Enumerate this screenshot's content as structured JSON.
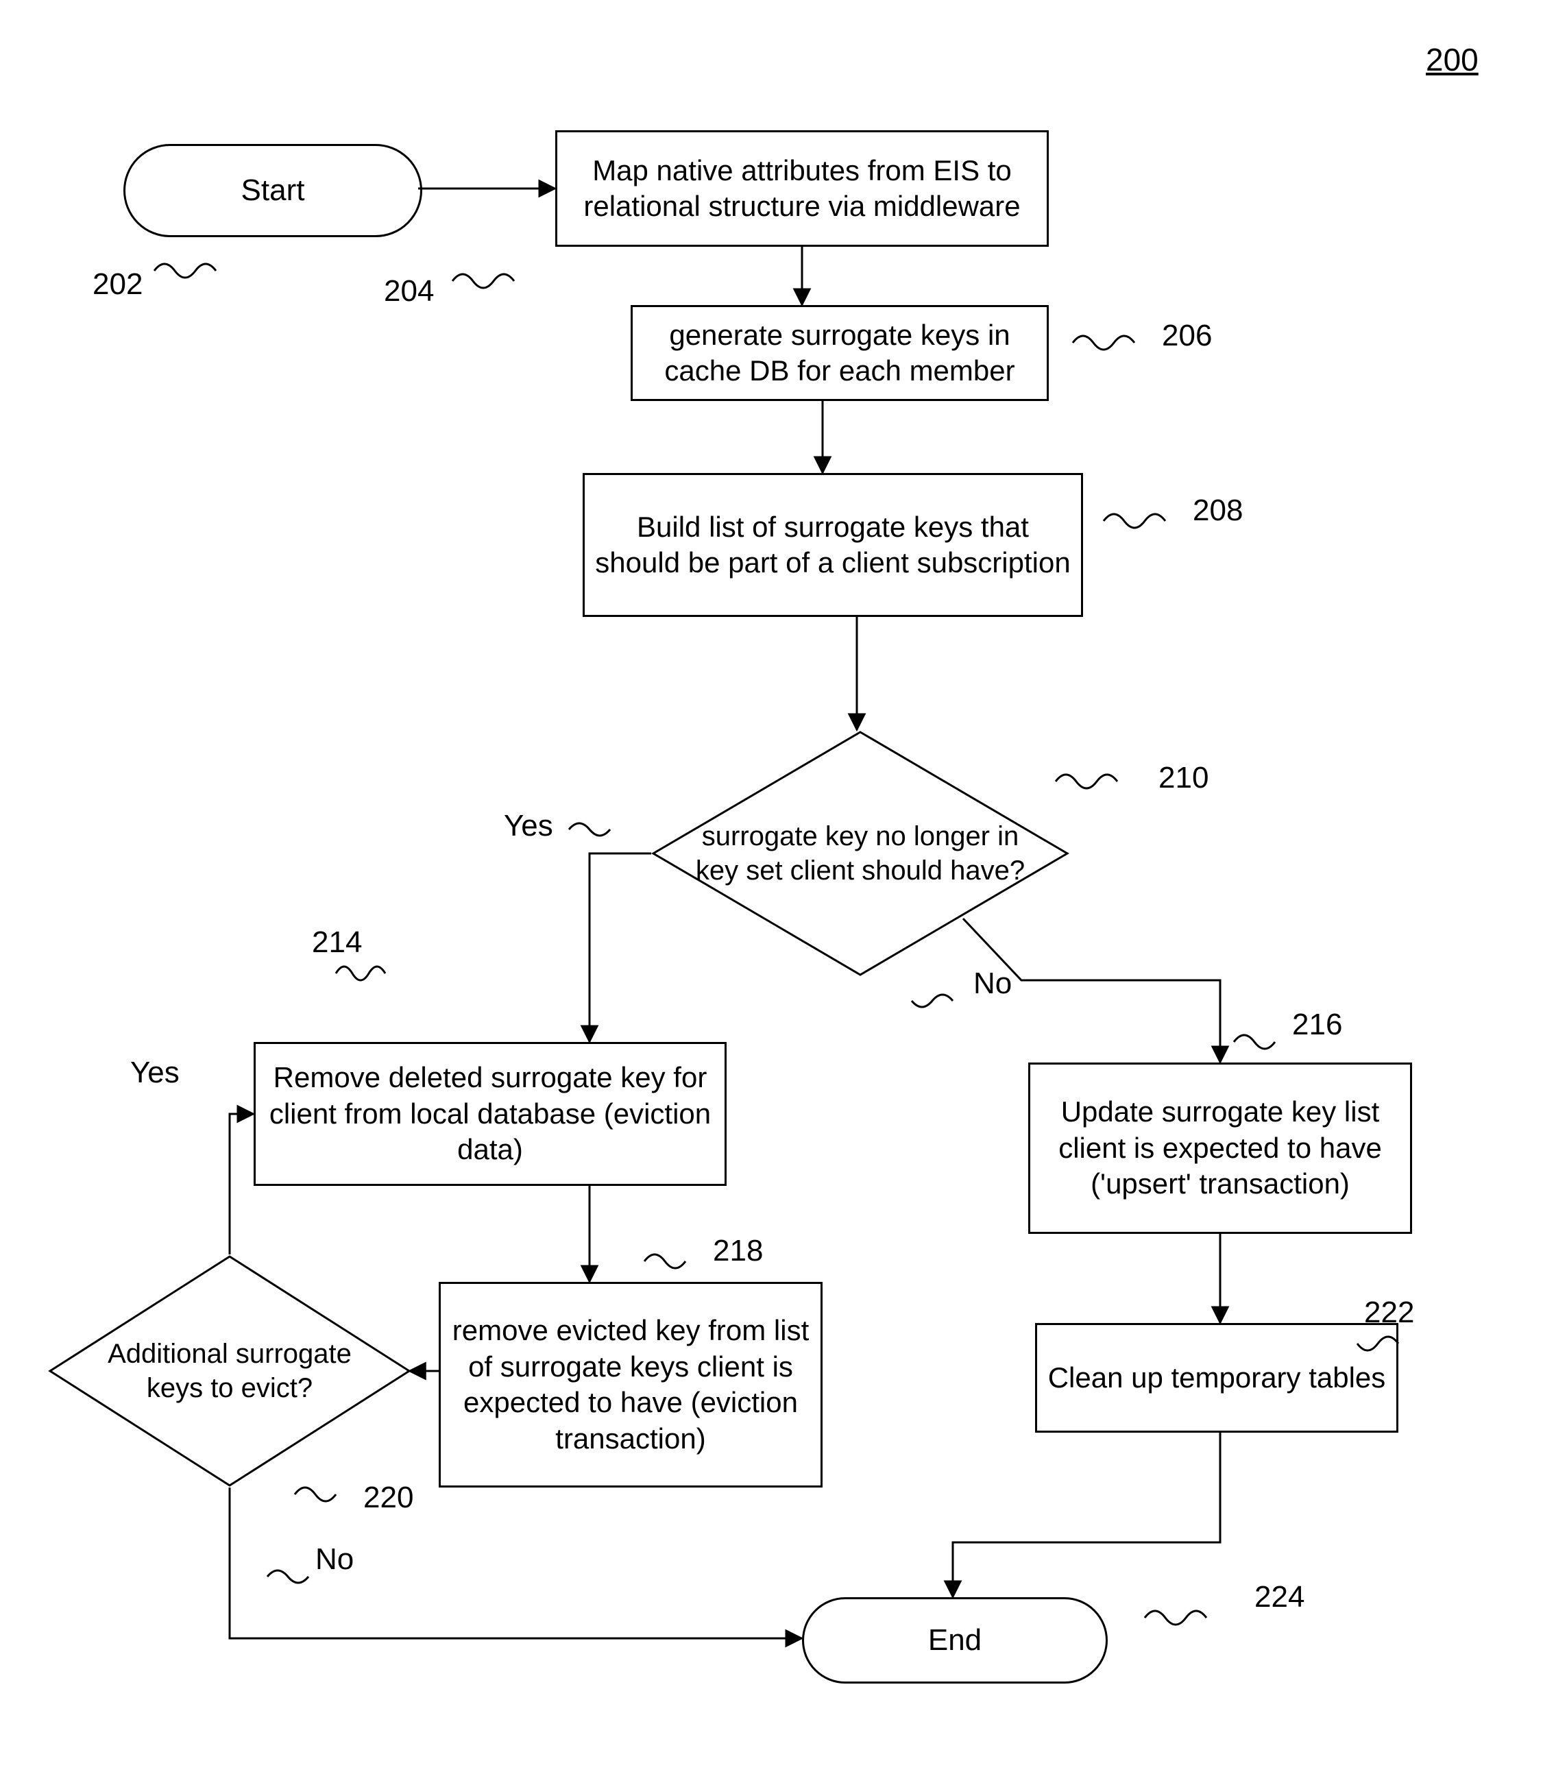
{
  "page_ref": "200",
  "nodes": {
    "start": "Start",
    "map": "Map native attributes from EIS to relational structure via middleware",
    "gen": "generate surrogate keys in cache DB for each member",
    "build": "Build list of surrogate keys that should be part of a client subscription",
    "dec1": "surrogate key no longer in key set client should have?",
    "remove": "Remove deleted surrogate key for client from local database (eviction data)",
    "update": "Update surrogate key list client is expected to have ('upsert' transaction)",
    "evict2": "remove evicted key from list of surrogate keys client is expected to have (eviction transaction)",
    "dec2": "Additional surrogate keys to evict?",
    "cleanup": "Clean up temporary tables",
    "end": "End"
  },
  "labels": {
    "yes": "Yes",
    "no": "No"
  },
  "refs": {
    "r202": "202",
    "r204": "204",
    "r206": "206",
    "r208": "208",
    "r210": "210",
    "r214": "214",
    "r216": "216",
    "r218": "218",
    "r220": "220",
    "r222": "222",
    "r224": "224"
  }
}
